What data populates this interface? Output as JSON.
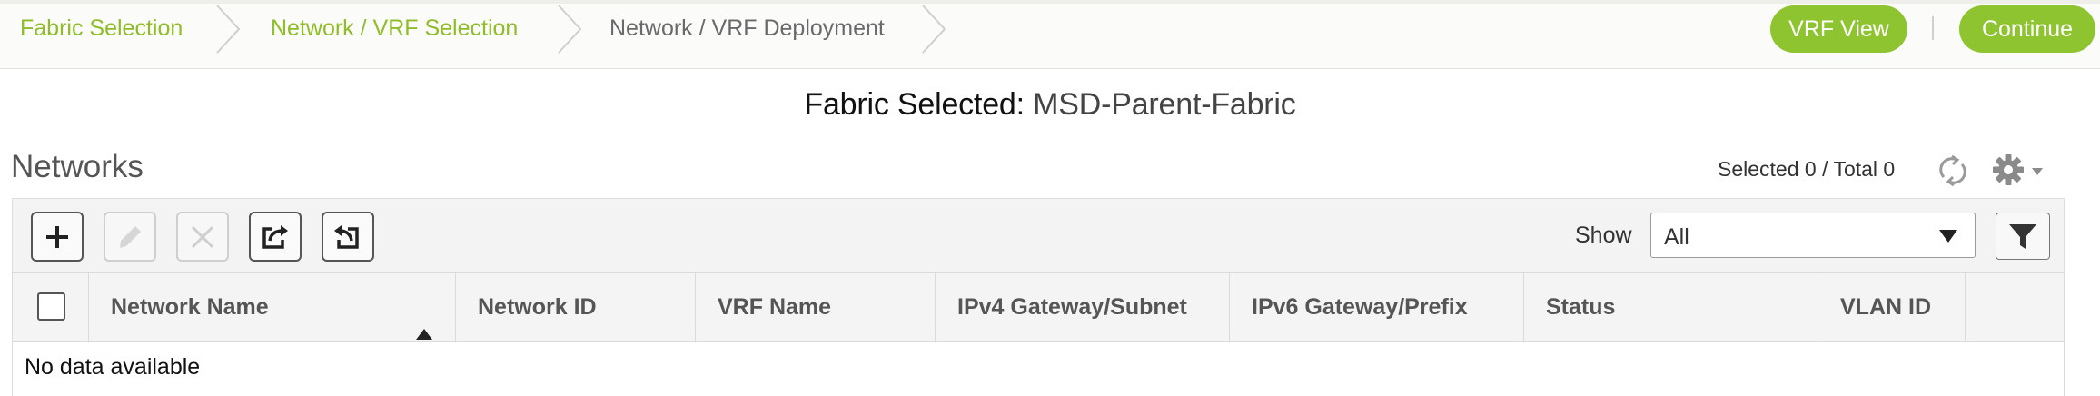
{
  "wizard": {
    "steps": [
      {
        "label": "Fabric Selection",
        "state": "done"
      },
      {
        "label": "Network / VRF Selection",
        "state": "done"
      },
      {
        "label": "Network / VRF Deployment",
        "state": "current"
      }
    ],
    "vrf_view_label": "VRF View",
    "continue_label": "Continue"
  },
  "fabric": {
    "prefix": "Fabric Selected:",
    "name": "MSD-Parent-Fabric"
  },
  "networks": {
    "title": "Networks",
    "selection_count": "Selected 0 / Total 0"
  },
  "toolbar": {
    "buttons": [
      {
        "icon": "plus-icon",
        "label": "Add",
        "enabled": true
      },
      {
        "icon": "pencil-icon",
        "label": "Edit",
        "enabled": false
      },
      {
        "icon": "x-icon",
        "label": "Delete",
        "enabled": false
      },
      {
        "icon": "export-icon",
        "label": "Export",
        "enabled": true
      },
      {
        "icon": "import-icon",
        "label": "Import",
        "enabled": true
      }
    ],
    "show_label": "Show",
    "show_value": "All"
  },
  "table": {
    "columns": [
      "Network Name",
      "Network ID",
      "VRF Name",
      "IPv4 Gateway/Subnet",
      "IPv6 Gateway/Prefix",
      "Status",
      "VLAN ID"
    ],
    "sort_column": "Network Name",
    "sort_direction": "ascending",
    "rows": [],
    "empty_text": "No data available"
  },
  "colors": {
    "accent_green": "#8dc42f",
    "step_done_text": "#8fbd28",
    "step_current_text": "#6a6a6a"
  }
}
